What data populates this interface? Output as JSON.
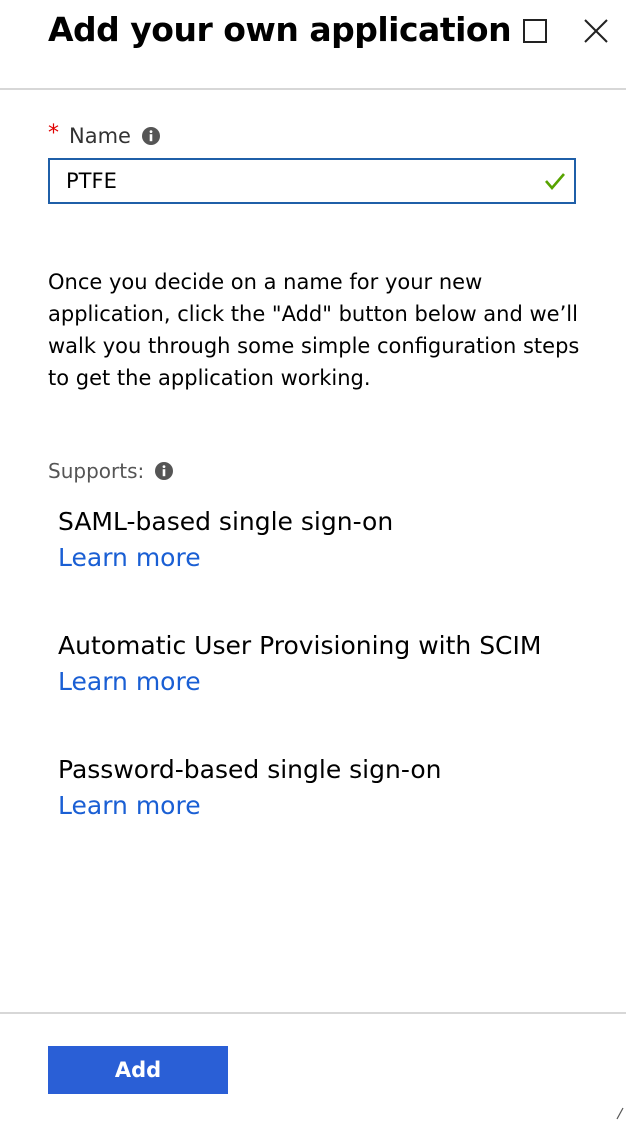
{
  "header": {
    "title": "Add your own application",
    "maximize_icon": "maximize-icon",
    "close_icon": "close-icon"
  },
  "form": {
    "name_label": "Name",
    "required_marker": "*",
    "name_value": "PTFE",
    "name_valid": true,
    "valid_color": "#57a300",
    "border_color": "#1f5fa8"
  },
  "help_text": "Once you decide on a name for your new application, click the \"Add\" button below and we’ll walk you through some simple configuration steps to get the application working.",
  "supports": {
    "label": "Supports:",
    "features": [
      {
        "title": "SAML-based single sign-on",
        "link": "Learn more"
      },
      {
        "title": "Automatic User Provisioning with SCIM",
        "link": "Learn more"
      },
      {
        "title": "Password-based single sign-on",
        "link": "Learn more"
      }
    ]
  },
  "footer": {
    "add_label": "Add",
    "add_color": "#2a5fd6"
  },
  "colors": {
    "required": "#e00000",
    "link": "#1a5fd4"
  }
}
